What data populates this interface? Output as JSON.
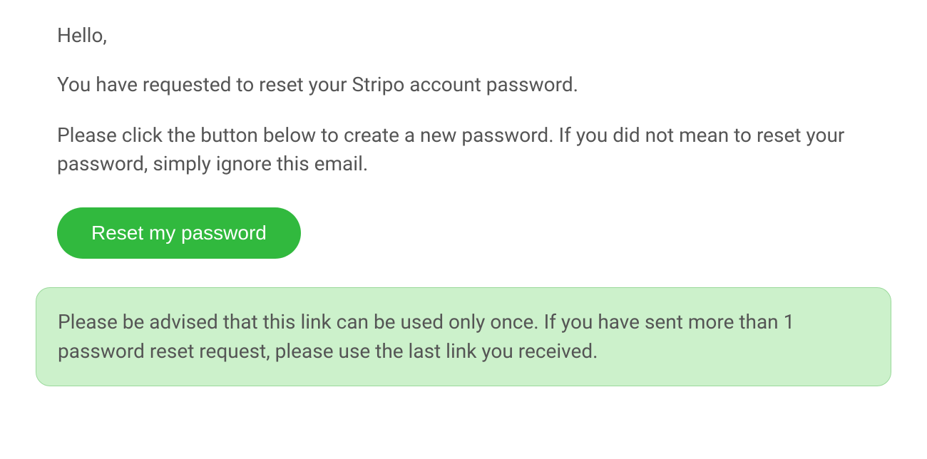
{
  "email": {
    "greeting": "Hello,",
    "line1": "You have requested to reset your Stripo account password.",
    "line2": "Please click the button below to create a new password. If you did not mean to reset your password, simply ignore this email.",
    "button_label": "Reset my password",
    "advisory": "Please be advised that this link can be used only once. If you have sent more than 1 password reset request, please use the last link you received."
  }
}
